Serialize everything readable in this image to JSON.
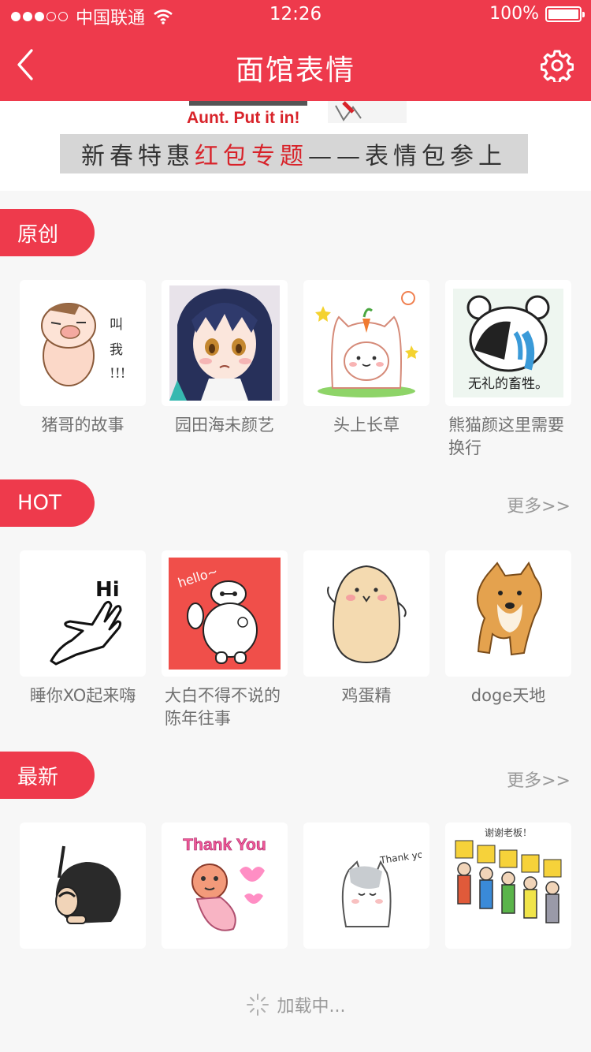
{
  "status": {
    "carrier": "中国联通",
    "time": "12:26",
    "battery": "100%",
    "signal_dots_filled": 3,
    "signal_dots_total": 5
  },
  "nav": {
    "title": "面馆表情",
    "back_icon": "chevron-left-icon",
    "settings_icon": "gear-icon"
  },
  "banner": {
    "english_text": "Aunt. Put it in!",
    "caption_dark1": "新春特惠",
    "caption_red": "红包专题",
    "caption_dark2": "——表情包参上"
  },
  "sections": {
    "original": {
      "tag": "原创",
      "items": [
        {
          "label": "猪哥的故事",
          "art_text": "叫 我 !!!"
        },
        {
          "label": "园田海未颜艺"
        },
        {
          "label": "头上长草"
        },
        {
          "label": "熊猫颜这里需要换行",
          "art_text": "无礼的畜牲。"
        }
      ]
    },
    "hot": {
      "tag": "HOT",
      "more": "更多>>",
      "items": [
        {
          "label": "睡你XO起来嗨",
          "art_text": "Hi"
        },
        {
          "label": "大白不得不说的陈年往事",
          "art_text": "hello~"
        },
        {
          "label": "鸡蛋精"
        },
        {
          "label": "doge天地"
        }
      ]
    },
    "newest": {
      "tag": "最新",
      "more": "更多>>",
      "items": [
        {
          "label": ""
        },
        {
          "label": "",
          "art_text": "Thank You"
        },
        {
          "label": "",
          "art_text": "Thank you!"
        },
        {
          "label": "",
          "art_text": "谢谢老板！"
        }
      ]
    }
  },
  "footer": {
    "loading": "加载中..."
  },
  "colors": {
    "brand": "#ee3a4c",
    "background": "#f7f7f7",
    "muted_text": "#707070"
  }
}
